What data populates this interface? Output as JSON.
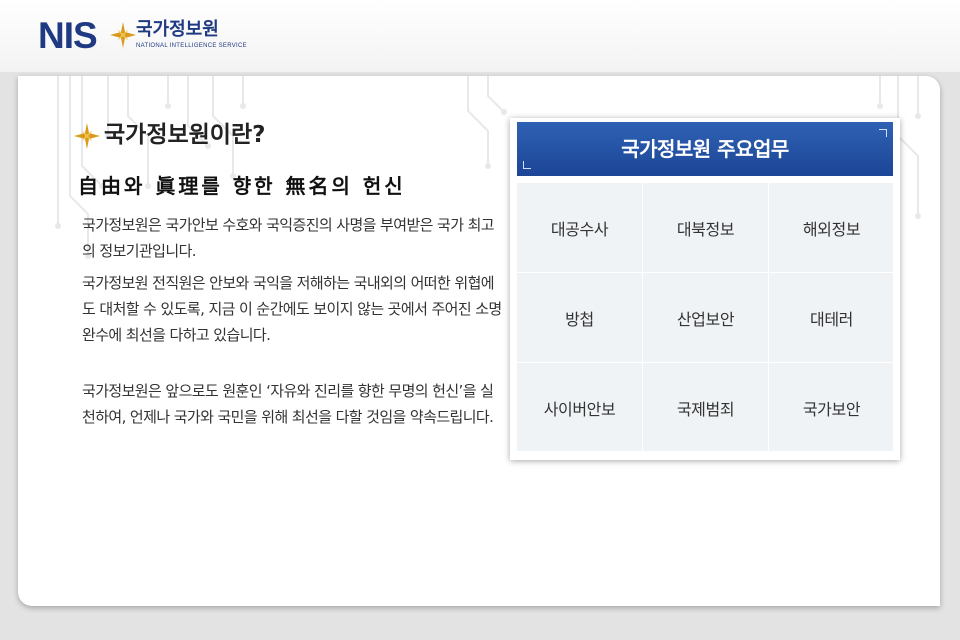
{
  "logo": {
    "brand": "NIS",
    "name_ko": "국가정보원",
    "name_en": "NATIONAL INTELLIGENCE SERVICE"
  },
  "intro": {
    "heading": "국가정보원이란?",
    "motto": "自由와 眞理를 향한 無名의 헌신",
    "paragraphs": [
      "국가정보원은 국가안보 수호와 국익증진의 사명을 부여받은 국가 최고의 정보기관입니다.",
      "국가정보원 전직원은 안보와 국익을 저해하는 국내외의 어떠한 위협에도 대처할 수 있도록, 지금 이 순간에도 보이지 않는 곳에서 주어진 소명완수에 최선을 다하고 있습니다.",
      "국가정보원은 앞으로도 원훈인 ‘자유와 진리를 향한 무명의 헌신’을 실천하여, 언제나 국가와 국민을 위해 최선을 다할 것임을 약속드립니다."
    ]
  },
  "duties": {
    "title": "국가정보원 주요업무",
    "items": [
      "대공수사",
      "대북정보",
      "해외정보",
      "방첩",
      "산업보안",
      "대테러",
      "사이버안보",
      "국제범죄",
      "국가보안"
    ]
  },
  "colors": {
    "brand_navy": "#1f3a82",
    "star_gold": "#d99a1e",
    "header_blue": "#2456a8",
    "grid_bg": "#f0f3f6"
  }
}
